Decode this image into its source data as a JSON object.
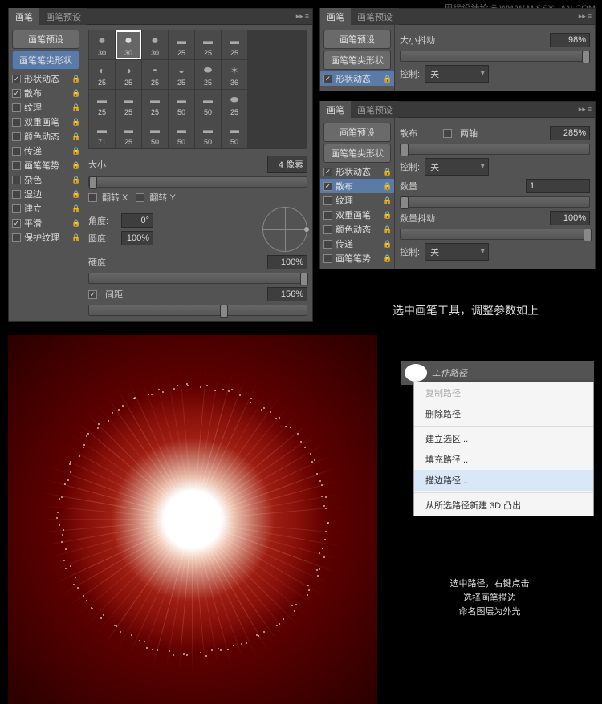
{
  "watermark": {
    "site": "思缘设计论坛",
    "url": "WWW.MISSYUAN.COM"
  },
  "panel1": {
    "tabs": [
      "画笔",
      "画笔预设"
    ],
    "active_tab": 0,
    "preset_btn": "画笔预设",
    "tip_btn": "画笔笔尖形状",
    "options": [
      {
        "label": "形状动态",
        "checked": true
      },
      {
        "label": "散布",
        "checked": true
      },
      {
        "label": "纹理",
        "checked": false
      },
      {
        "label": "双重画笔",
        "checked": false
      },
      {
        "label": "颜色动态",
        "checked": false
      },
      {
        "label": "传递",
        "checked": false
      },
      {
        "label": "画笔笔势",
        "checked": false
      },
      {
        "label": "杂色",
        "checked": false
      },
      {
        "label": "湿边",
        "checked": false
      },
      {
        "label": "建立",
        "checked": false
      },
      {
        "label": "平滑",
        "checked": true
      },
      {
        "label": "保护纹理",
        "checked": false
      }
    ],
    "brushes": [
      30,
      30,
      30,
      25,
      25,
      25,
      25,
      25,
      25,
      25,
      25,
      36,
      25,
      25,
      25,
      50,
      50,
      25,
      71,
      25,
      50,
      50,
      50,
      50
    ],
    "brush_sel": 1,
    "size_label": "大小",
    "size_val": "4 像素",
    "flipx": "翻转 X",
    "flipy": "翻转 Y",
    "angle_label": "角度:",
    "angle_val": "0°",
    "round_label": "圆度:",
    "round_val": "100%",
    "hardness_label": "硬度",
    "hardness_val": "100%",
    "spacing_label": "间距",
    "spacing_checked": true,
    "spacing_val": "156%"
  },
  "panel2": {
    "tabs": [
      "画笔",
      "画笔预设"
    ],
    "active_tab": 0,
    "preset_btn": "画笔预设",
    "tip_btn": "画笔笔尖形状",
    "options": [
      {
        "label": "形状动态",
        "checked": true,
        "active": true
      }
    ],
    "jitter_label": "大小抖动",
    "jitter_val": "98%",
    "ctrl_label": "控制:",
    "ctrl_val": "关"
  },
  "panel3": {
    "tabs": [
      "画笔",
      "画笔预设"
    ],
    "active_tab": 0,
    "preset_btn": "画笔预设",
    "tip_btn": "画笔笔尖形状",
    "options": [
      {
        "label": "形状动态",
        "checked": true
      },
      {
        "label": "散布",
        "checked": true,
        "active": true
      },
      {
        "label": "纹理",
        "checked": false
      },
      {
        "label": "双重画笔",
        "checked": false
      },
      {
        "label": "颜色动态",
        "checked": false
      },
      {
        "label": "传递",
        "checked": false
      },
      {
        "label": "画笔笔势",
        "checked": false
      }
    ],
    "scatter_label": "散布",
    "both_label": "两轴",
    "both_checked": false,
    "scatter_val": "285%",
    "ctrl_label": "控制:",
    "ctrl_val": "关",
    "count_label": "数量",
    "count_val": "1",
    "cjitter_label": "数量抖动",
    "cjitter_val": "100%",
    "ctrl2_label": "控制:",
    "ctrl2_val": "关"
  },
  "caption1": "选中画笔工具，调整参数如上",
  "path": {
    "title": "工作路径"
  },
  "menu": {
    "items": [
      {
        "label": "复制路径",
        "disabled": true
      },
      {
        "label": "删除路径"
      },
      {
        "sep": true
      },
      {
        "label": "建立选区..."
      },
      {
        "label": "填充路径..."
      },
      {
        "label": "描边路径...",
        "hover": true
      },
      {
        "sep": true
      },
      {
        "label": "从所选路径新建 3D 凸出"
      }
    ]
  },
  "caption2": [
    "选中路径，右键点击",
    "选择画笔描边",
    "命名图层为外光"
  ]
}
